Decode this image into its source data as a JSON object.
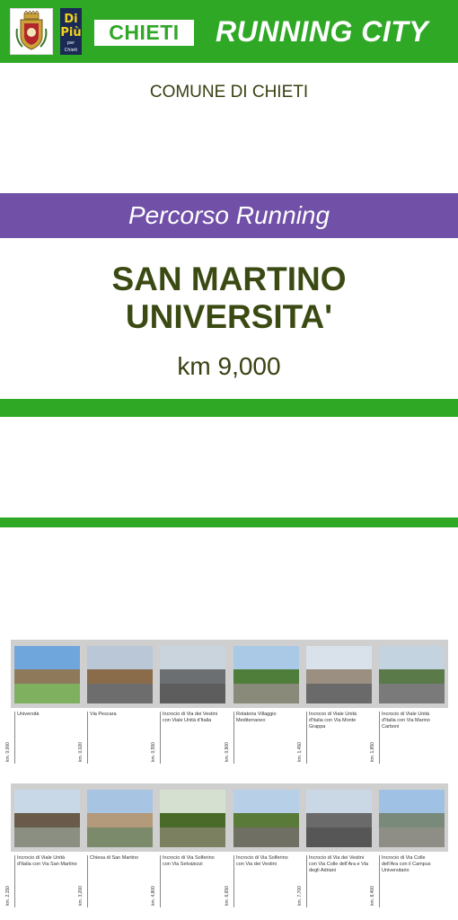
{
  "header": {
    "brand_label": "CHIETI",
    "title": "RUNNING CITY",
    "logo_text": "Di Più",
    "logo_subtext": "per Chieti"
  },
  "comune": "COMUNE DI CHIETI",
  "subtitle": "Percorso Running",
  "route": {
    "line1": "SAN MARTINO",
    "line2": "UNIVERSITA'",
    "distance": "km 9,000"
  },
  "colors": {
    "green": "#2fa826",
    "purple": "#7150a8",
    "text_olive": "#3a4012"
  },
  "strip1": [
    {
      "caption": "Università",
      "km": "km. 0,000"
    },
    {
      "caption": "Via Pescara",
      "km": "km. 0,020"
    },
    {
      "caption": "Incrocio di Via dei Vestini con Viale Unità d'Italia",
      "km": "km. 0,550"
    },
    {
      "caption": "Rotatoria Villaggio Mediterraneo",
      "km": "km. 0,900"
    },
    {
      "caption": "Incrocio di Viale Unità d'Italia con Via Monte Grappa",
      "km": "km. 1,450"
    },
    {
      "caption": "Incrocio di Viale Unità d'Italia con Via Marino Carboni",
      "km": "km. 1,850"
    }
  ],
  "strip2": [
    {
      "caption": "Incrocio di Viale Unità d'Italia con Via San Martino",
      "km": "km. 2,150"
    },
    {
      "caption": "Chiesa di San Martino",
      "km": "km. 3,200"
    },
    {
      "caption": "Incrocio di Via Solferino con Via Selvaiezzi",
      "km": "km. 4,800"
    },
    {
      "caption": "Incrocio di Via Solferino con Via dei Vestini",
      "km": "km. 6,650"
    },
    {
      "caption": "Incrocio di Via dei Vestini con Via Colle dell'Ara e Via degli Adriani",
      "km": "km. 7,700"
    },
    {
      "caption": "Incrocio di Via Colle dell'Ara con il Campus Universitario",
      "km": "km. 8,400"
    }
  ]
}
